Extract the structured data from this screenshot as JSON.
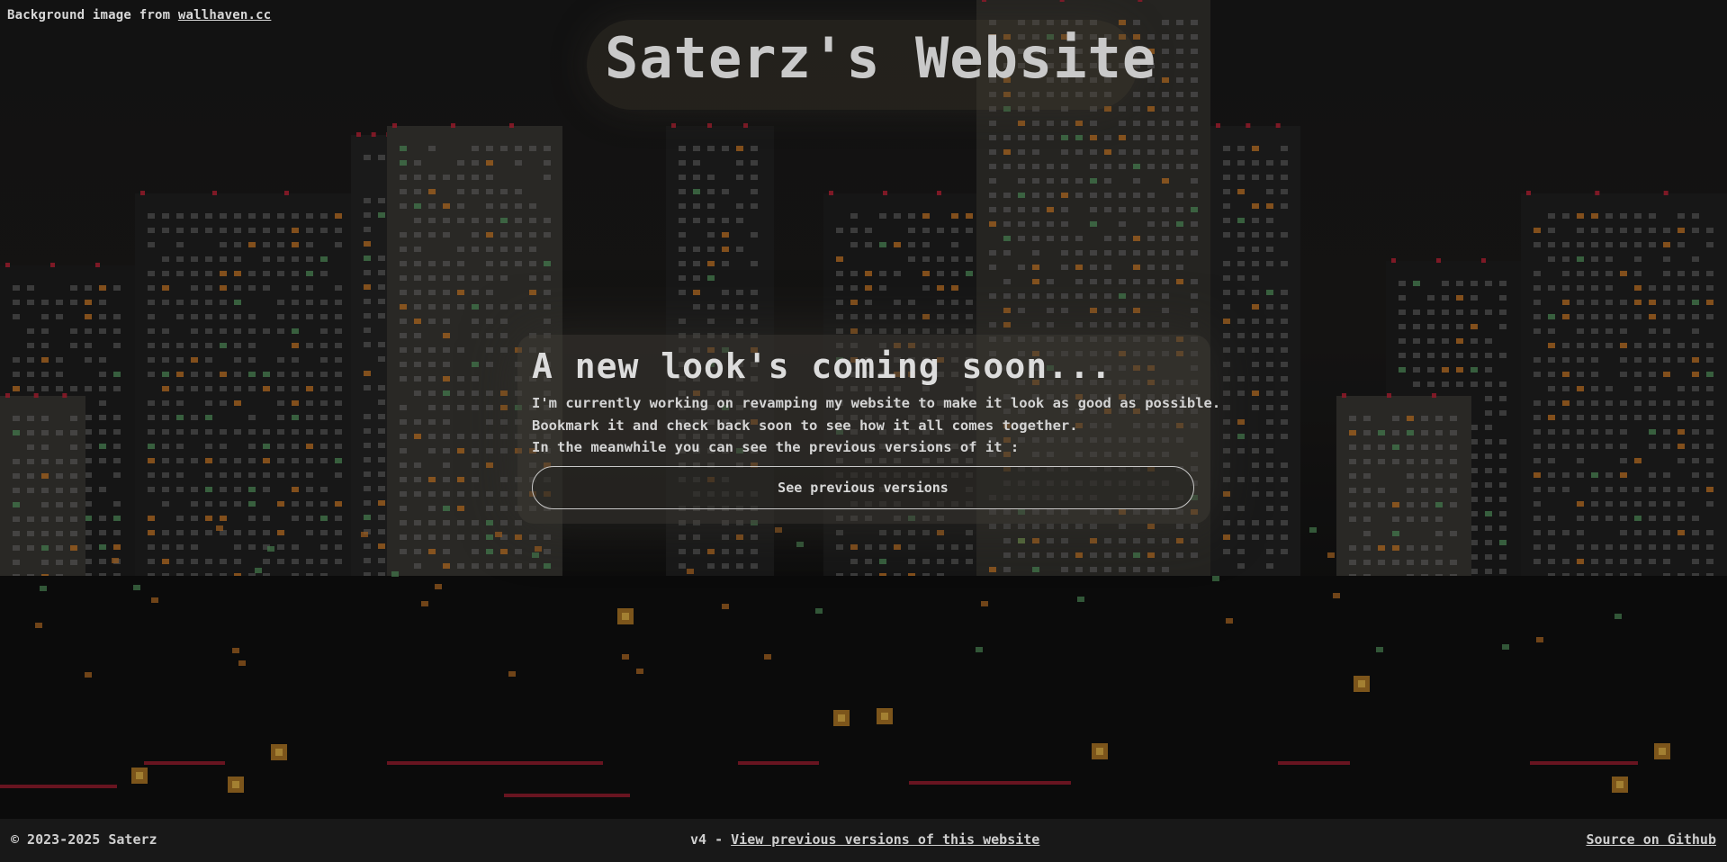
{
  "background_credit": {
    "prefix": "Background image from",
    "link_text": "wallhaven.cc"
  },
  "site": {
    "title": "Saterz's Website"
  },
  "announcement": {
    "heading": "A new look's coming soon...",
    "lines": [
      "I'm currently working on revamping my website to make it look as good as possible.",
      "Bookmark it and check back soon to see how it all comes together.",
      "In the meanwhile you can see the previous versions of it :"
    ],
    "button_label": "See previous versions"
  },
  "footer": {
    "copyright": "© 2023-2025 Saterz",
    "version_prefix": "v4 -",
    "previous_versions_link": "View previous versions of this website",
    "source_link": "Source on Github"
  },
  "colors": {
    "background": "#141414",
    "text": "#cfcfcf",
    "building": "#1b1b1b",
    "window_light": "#7d7d7d",
    "window_orange": "#d9822b",
    "window_green": "#5ea66a",
    "roof_red": "#c8243a"
  }
}
